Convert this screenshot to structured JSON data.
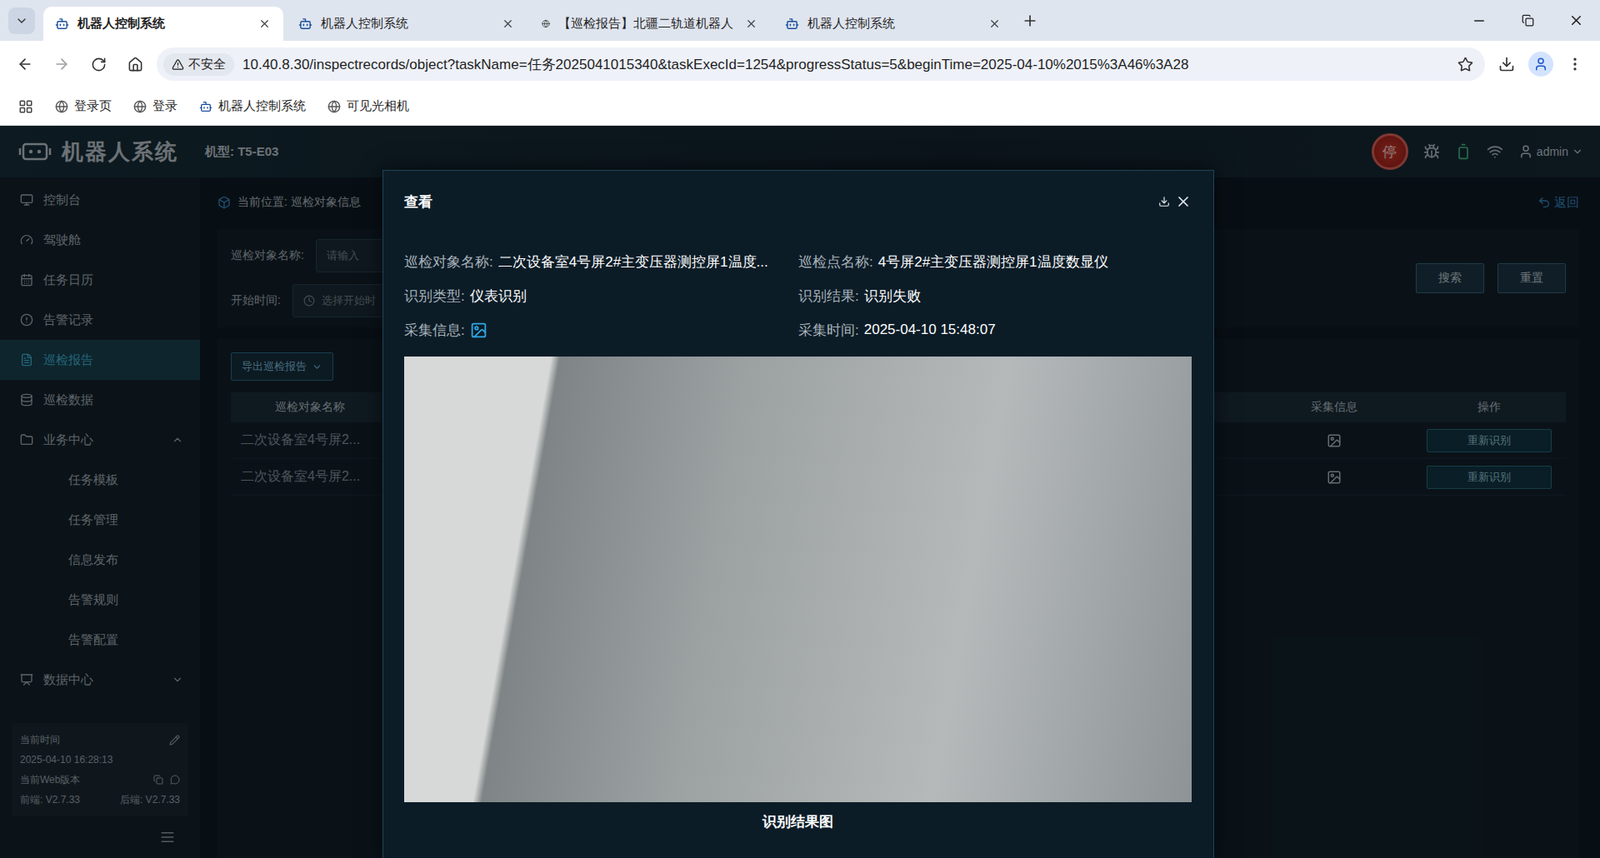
{
  "browser": {
    "tabs": [
      {
        "label": "机器人控制系统",
        "selected": true,
        "kind": "app"
      },
      {
        "label": "机器人控制系统",
        "selected": false,
        "kind": "app"
      },
      {
        "label": "【巡检报告】北疆二轨道机器人",
        "selected": false,
        "kind": "web"
      },
      {
        "label": "机器人控制系统",
        "selected": false,
        "kind": "app"
      }
    ],
    "security": "不安全",
    "url": "10.40.8.30/inspectrecords/object?taskName=任务2025041015340&taskExecId=1254&progressStatus=5&beginTime=2025-04-10%2015%3A46%3A28",
    "bookmarks": [
      {
        "label": "登录页",
        "kind": "web"
      },
      {
        "label": "登录",
        "kind": "web"
      },
      {
        "label": "机器人控制系统",
        "kind": "app"
      },
      {
        "label": "可见光相机",
        "kind": "web"
      }
    ]
  },
  "header": {
    "logo": "机器人系统",
    "model": "机型:  T5-E03",
    "stop": "停",
    "user": "admin"
  },
  "sidebar": {
    "items": [
      {
        "label": "控制台",
        "kind": "item",
        "selected": false
      },
      {
        "label": "驾驶舱",
        "kind": "item",
        "selected": false
      },
      {
        "label": "任务日历",
        "kind": "item",
        "selected": false
      },
      {
        "label": "告警记录",
        "kind": "item",
        "selected": false
      },
      {
        "label": "巡检报告",
        "kind": "item",
        "selected": true
      },
      {
        "label": "巡检数据",
        "kind": "item",
        "selected": false
      },
      {
        "label": "业务中心",
        "kind": "group",
        "selected": false,
        "expanded": true,
        "children": [
          {
            "label": "任务模板",
            "selected": false
          },
          {
            "label": "任务管理",
            "selected": false
          },
          {
            "label": "信息发布",
            "selected": false
          },
          {
            "label": "告警规则",
            "selected": false
          },
          {
            "label": "告警配置",
            "selected": false
          }
        ]
      },
      {
        "label": "数据中心",
        "kind": "group",
        "selected": false,
        "expanded": false,
        "children": []
      }
    ],
    "footer": {
      "time_label": "当前时间",
      "time": "2025-04-10 16:28:13",
      "version_label": "当前Web版本",
      "frontend": "前端:  V2.7.33",
      "backend": "后端:  V2.7.33"
    }
  },
  "page": {
    "breadcrumb": "当前位置:  巡检对象信息",
    "back": "返回",
    "filters": [
      {
        "label": "巡检对象名称:",
        "placeholder": "请输入",
        "kind": "text"
      },
      {
        "label": "开始时间:",
        "placeholder": "选择开始时",
        "kind": "date"
      }
    ],
    "buttons": [
      "搜索",
      "重置"
    ],
    "export": "导出巡检报告",
    "table": {
      "columns": [
        "巡检对象名称",
        "采集信息",
        "操作"
      ],
      "rows": [
        {
          "name": "二次设备室4号屏2...",
          "action": "重新识别"
        },
        {
          "name": "二次设备室4号屏2...",
          "action": "重新识别"
        }
      ]
    }
  },
  "modal": {
    "title": "查看",
    "fields": [
      {
        "label": "巡检对象名称:",
        "value": "二次设备室4号屏2#主变压器测控屏1温度...",
        "kind": "text"
      },
      {
        "label": "巡检点名称:",
        "value": "4号屏2#主变压器测控屏1温度数显仪",
        "kind": "text"
      },
      {
        "label": "识别类型:",
        "value": "仪表识别",
        "kind": "text"
      },
      {
        "label": "识别结果:",
        "value": "识别失败",
        "kind": "text"
      },
      {
        "label": "采集信息:",
        "value": "",
        "kind": "image"
      },
      {
        "label": "采集时间:",
        "value": "2025-04-10 15:48:07",
        "kind": "text"
      }
    ],
    "caption": "识别结果图"
  }
}
